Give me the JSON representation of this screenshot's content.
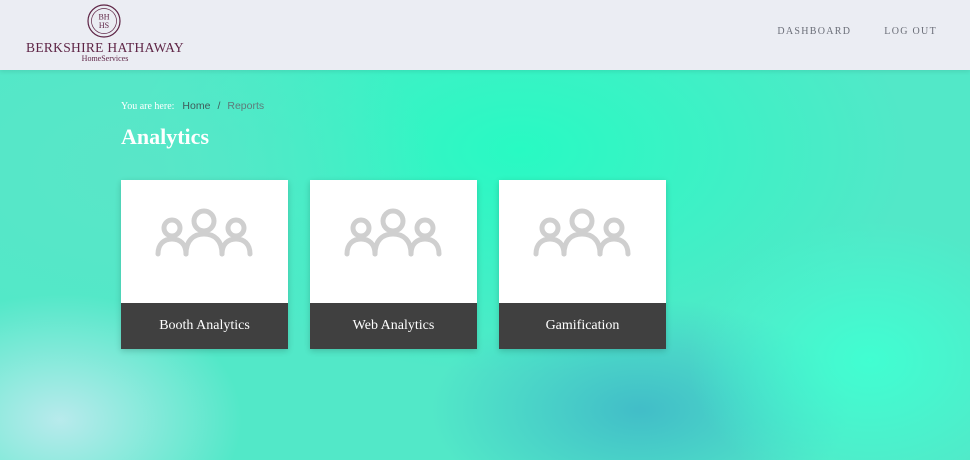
{
  "header": {
    "logo": {
      "seal_text": "BHHS",
      "name": "BERKSHIRE HATHAWAY",
      "sub": "HomeServices",
      "brand_color": "#5e2445"
    },
    "nav": {
      "dashboard": "DASHBOARD",
      "logout": "LOG OUT"
    }
  },
  "breadcrumb": {
    "label": "You are here:",
    "home": "Home",
    "separator": "/",
    "current": "Reports"
  },
  "page": {
    "title": "Analytics"
  },
  "cards": [
    {
      "label": "Booth Analytics",
      "icon": "users-group-icon"
    },
    {
      "label": "Web Analytics",
      "icon": "users-group-icon"
    },
    {
      "label": "Gamification",
      "icon": "users-group-icon"
    }
  ],
  "colors": {
    "background": "#52e8c8",
    "topbar": "#ebedf3",
    "card_footer": "#404040"
  }
}
